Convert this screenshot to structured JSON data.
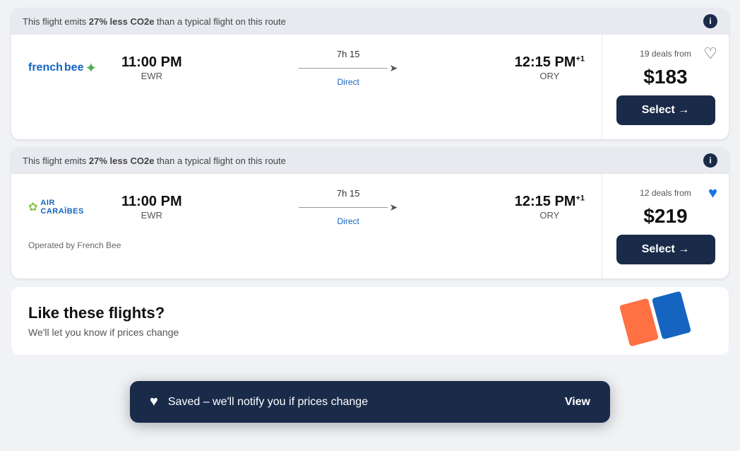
{
  "flights": [
    {
      "id": "flight-1",
      "eco_banner": {
        "text_before": "This flight emits ",
        "highlight": "27% less CO2e",
        "text_after": " than a typical flight on this route"
      },
      "airline": "frenchbee",
      "airline_display": "frenchbee",
      "departure_time": "11:00 PM",
      "departure_airport": "EWR",
      "duration": "7h 15",
      "stops": "Direct",
      "arrival_time": "12:15 PM",
      "arrival_superscript": "+1",
      "arrival_airport": "ORY",
      "deals_text": "19 deals from",
      "price": "$183",
      "select_label": "Select →",
      "heart_filled": false,
      "operated_by": null
    },
    {
      "id": "flight-2",
      "eco_banner": {
        "text_before": "This flight emits ",
        "highlight": "27% less CO2e",
        "text_after": " than a typical flight on this route"
      },
      "airline": "aircaraibes",
      "airline_display": "AIR CARAIBES",
      "departure_time": "11:00 PM",
      "departure_airport": "EWR",
      "duration": "7h 15",
      "stops": "Direct",
      "arrival_time": "12:15 PM",
      "arrival_superscript": "+1",
      "arrival_airport": "ORY",
      "deals_text": "12 deals from",
      "price": "$219",
      "select_label": "Select →",
      "heart_filled": true,
      "operated_by": "Operated by French Bee"
    }
  ],
  "third_section": {
    "title": "Like these flights?",
    "subtitle": "We'll let you know if prices change"
  },
  "toast": {
    "text": "Saved – we'll notify you if prices change",
    "action_label": "View"
  }
}
